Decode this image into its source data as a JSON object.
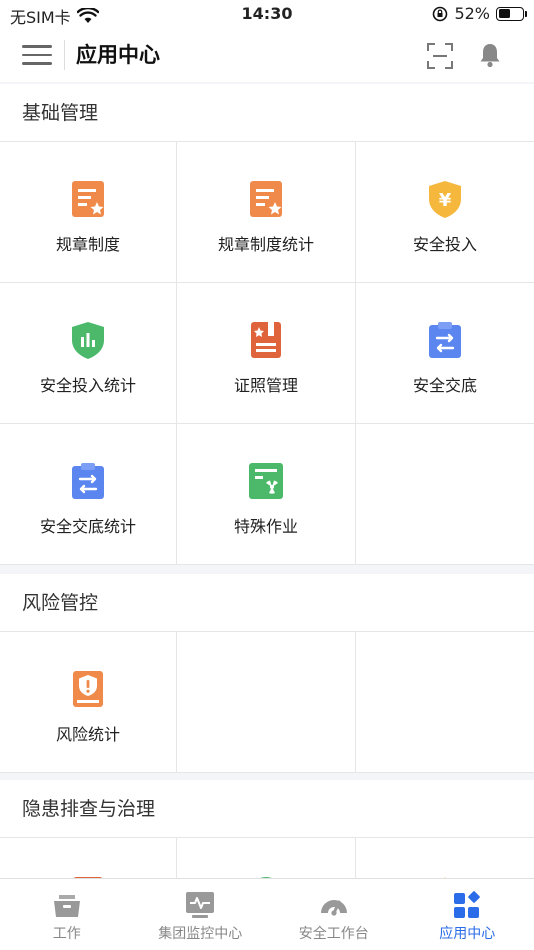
{
  "status_bar": {
    "carrier": "无SIM卡",
    "time": "14:30",
    "battery": "52%",
    "battery_level": 0.52
  },
  "nav": {
    "title": "应用中心"
  },
  "sections": [
    {
      "title": "基础管理",
      "items": [
        {
          "label": "规章制度",
          "icon": "regulation-icon"
        },
        {
          "label": "规章制度统计",
          "icon": "regulation-stats-icon"
        },
        {
          "label": "安全投入",
          "icon": "safety-investment-icon"
        },
        {
          "label": "安全投入统计",
          "icon": "investment-stats-icon"
        },
        {
          "label": "证照管理",
          "icon": "license-icon"
        },
        {
          "label": "安全交底",
          "icon": "safety-briefing-icon"
        },
        {
          "label": "安全交底统计",
          "icon": "briefing-stats-icon"
        },
        {
          "label": "特殊作业",
          "icon": "special-work-icon"
        }
      ]
    },
    {
      "title": "风险管控",
      "items": [
        {
          "label": "风险统计",
          "icon": "risk-stats-icon"
        }
      ]
    },
    {
      "title": "隐患排查与治理",
      "items": []
    }
  ],
  "tabs": [
    {
      "label": "工作",
      "icon": "work-icon"
    },
    {
      "label": "集团监控中心",
      "icon": "monitor-icon"
    },
    {
      "label": "安全工作台",
      "icon": "dashboard-icon"
    },
    {
      "label": "应用中心",
      "icon": "apps-icon",
      "active": true
    }
  ],
  "colors": {
    "accent": "#2b6de8",
    "orange": "#f08a4b",
    "yellow": "#f5b83d",
    "green": "#4cb86a",
    "red": "#e0643b",
    "blue": "#5b86f0"
  }
}
